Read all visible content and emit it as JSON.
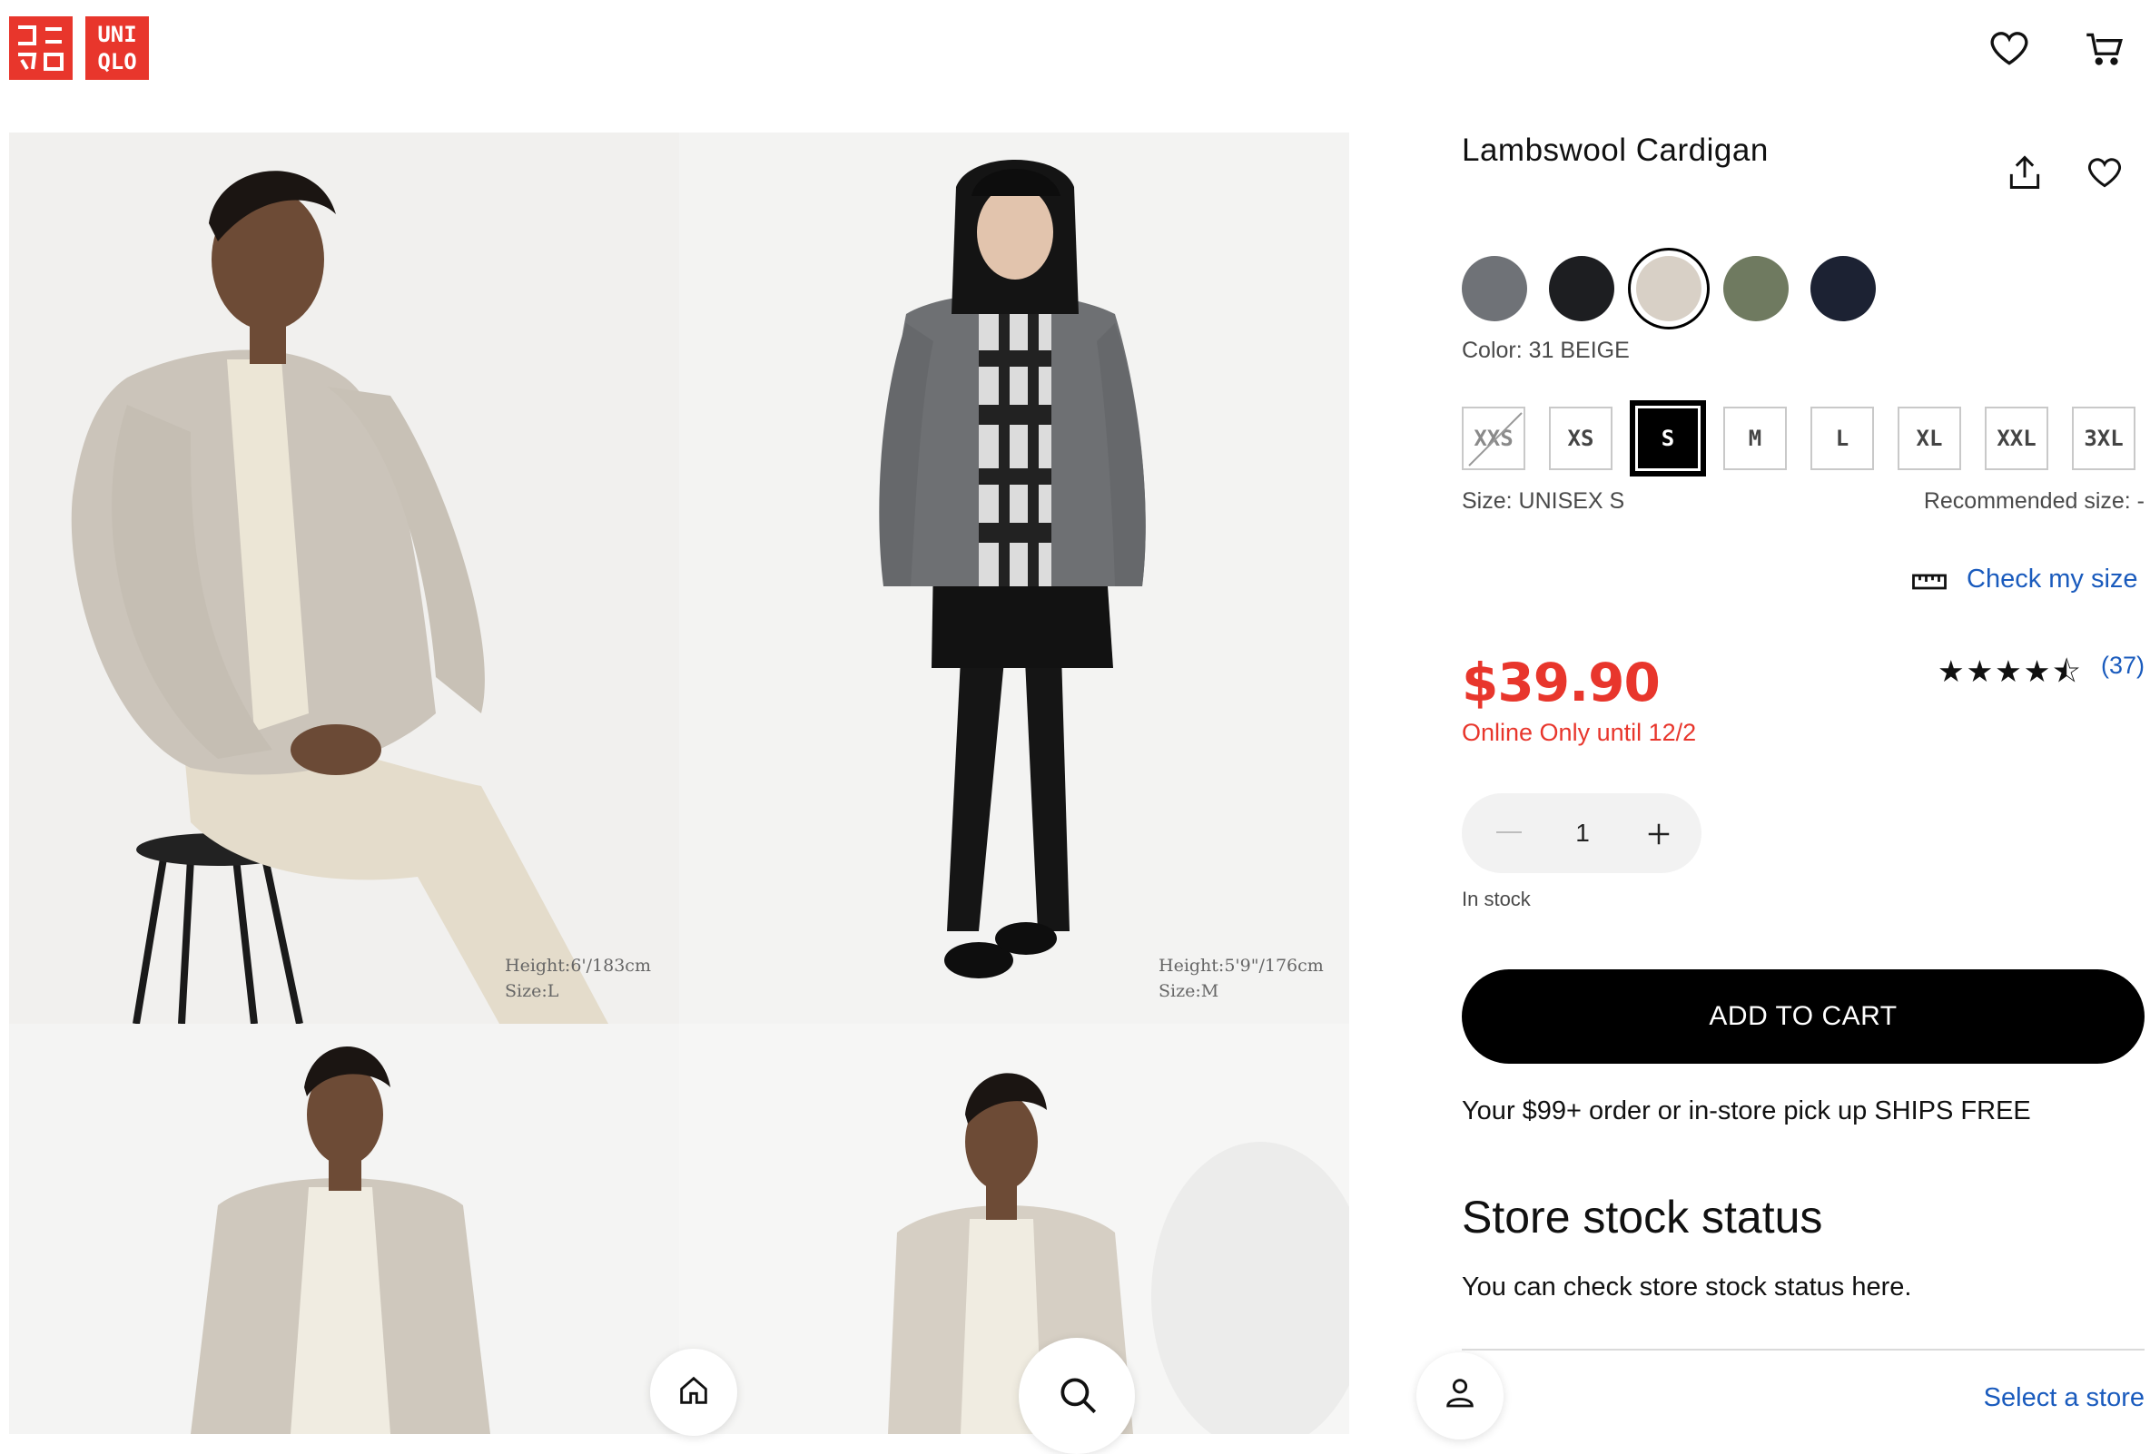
{
  "header": {
    "logo_top_left": "ユニ",
    "logo_bottom_left": "クロ",
    "logo_top_right": "UNI",
    "logo_bottom_right": "QLO",
    "icons": [
      "heart-icon",
      "cart-icon"
    ]
  },
  "gallery": [
    {
      "caption_height": "Height:6'/183cm",
      "caption_size": "Size:L"
    },
    {
      "caption_height": "Height:5'9\"/176cm",
      "caption_size": "Size:M"
    },
    {},
    {}
  ],
  "product": {
    "title": "Lambswool Cardigan",
    "color_label": "Color: 31 BEIGE",
    "swatches": [
      {
        "name": "gray",
        "hex": "#6f7277"
      },
      {
        "name": "black",
        "hex": "#1d1e21"
      },
      {
        "name": "beige",
        "hex": "#d8d0c6",
        "selected": true
      },
      {
        "name": "olive",
        "hex": "#6f7a60"
      },
      {
        "name": "navy",
        "hex": "#1c2233"
      }
    ],
    "sizes": [
      {
        "label": "XXS",
        "available": false
      },
      {
        "label": "XS",
        "available": true
      },
      {
        "label": "S",
        "available": true,
        "selected": true
      },
      {
        "label": "M",
        "available": true
      },
      {
        "label": "L",
        "available": true
      },
      {
        "label": "XL",
        "available": true
      },
      {
        "label": "XXL",
        "available": true
      },
      {
        "label": "3XL",
        "available": true
      }
    ],
    "size_label": "Size: UNISEX S",
    "recommended_size": "Recommended size: -",
    "check_size_link": "Check my size",
    "price": "$39.90",
    "promo": "Online Only until 12/2",
    "rating_stars": "★★★★⯪",
    "rating_value": 4.5,
    "review_count": "(37)",
    "quantity": "1",
    "stock_status": "In stock",
    "add_to_cart": "ADD TO CART",
    "shipping_note": "Your $99+ order or in-store pick up SHIPS FREE",
    "store_stock_heading": "Store stock status",
    "store_stock_text": "You can check store stock status here.",
    "select_store_link": "Select a store"
  },
  "colors": {
    "brand_red": "#e8362c",
    "link_blue": "#1a5bbd"
  },
  "bottom_nav": [
    "home-icon",
    "search-icon",
    "account-icon"
  ]
}
